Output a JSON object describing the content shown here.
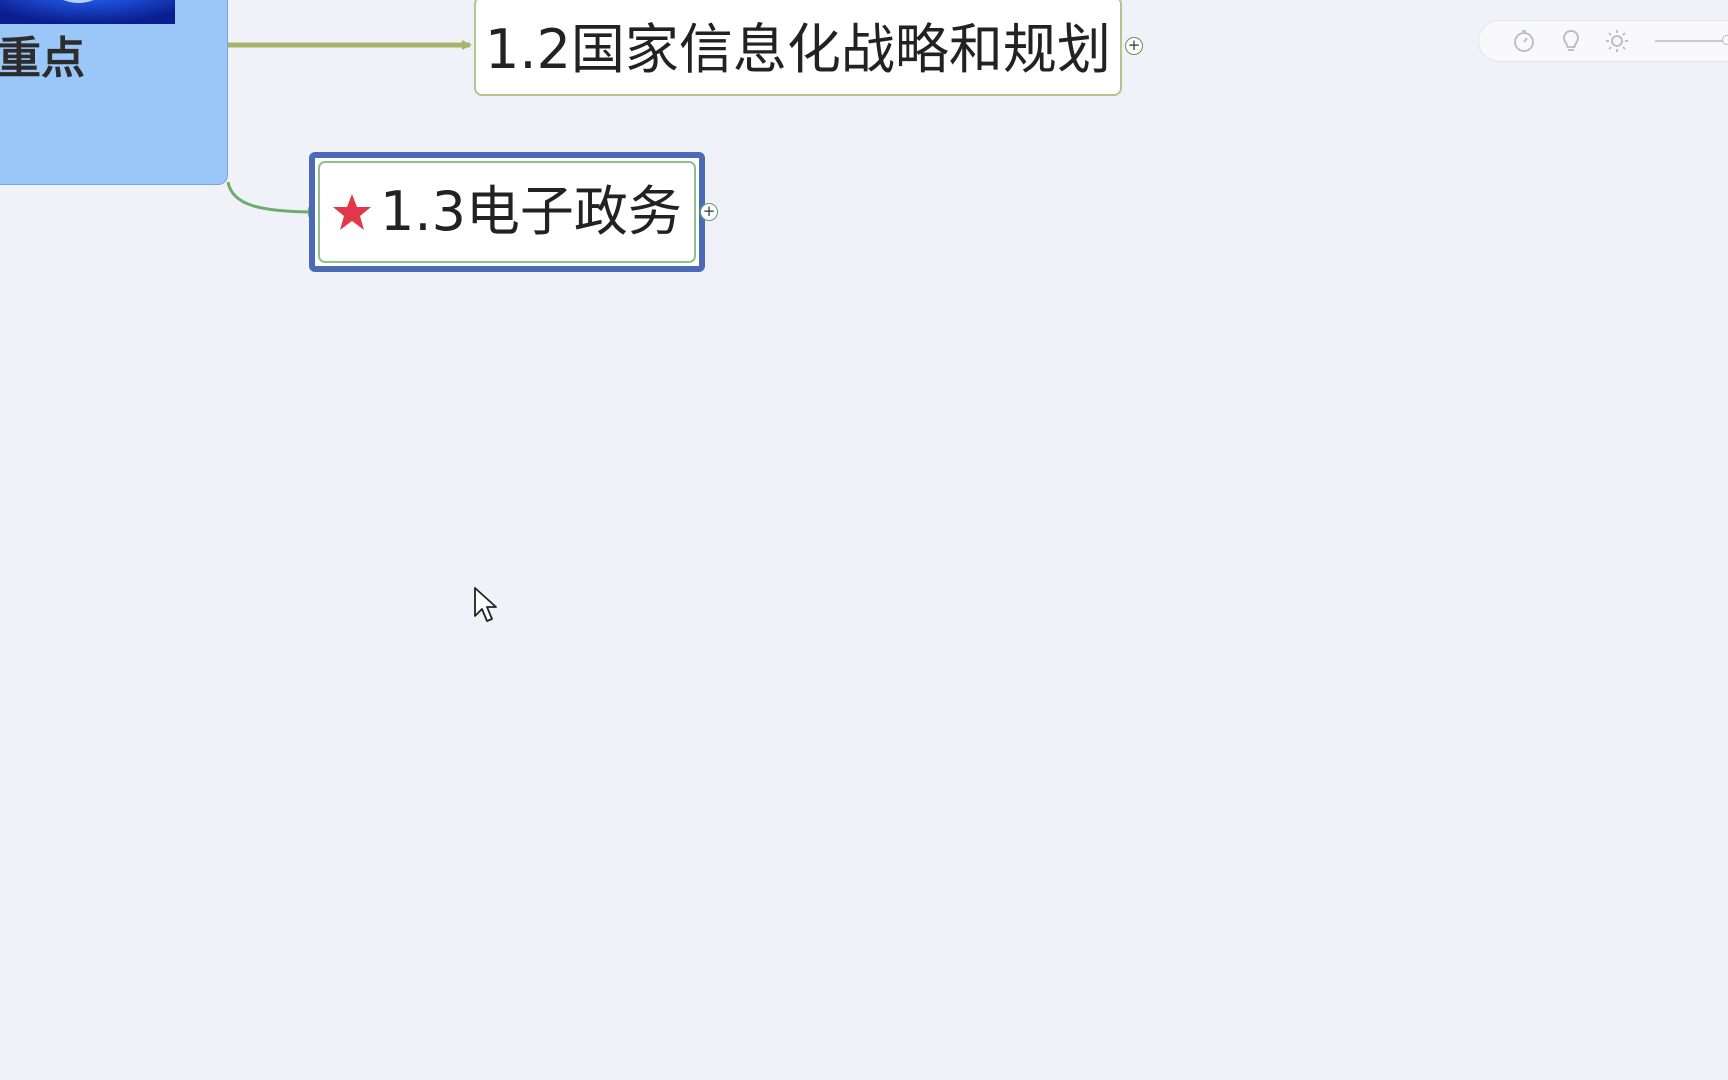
{
  "mindmap": {
    "central_topic": {
      "label": "重点"
    },
    "topics": [
      {
        "label": "1.2国家信息化战略和规划",
        "expand_symbol": "+"
      },
      {
        "label": "1.3电子政务",
        "marker": "star-icon",
        "marker_color": "#e2374a",
        "selected": true,
        "expand_symbol": "+"
      }
    ]
  },
  "toolbar": {
    "icons": [
      "timer-icon",
      "lightbulb-icon",
      "brightness-icon"
    ]
  },
  "colors": {
    "background": "#f1f2f9",
    "central_fill": "#9ac6f8",
    "selection": "#4c6ab5",
    "branch_12": "#a9b36a",
    "branch_13": "#6aaf6a",
    "star": "#e2374a"
  }
}
